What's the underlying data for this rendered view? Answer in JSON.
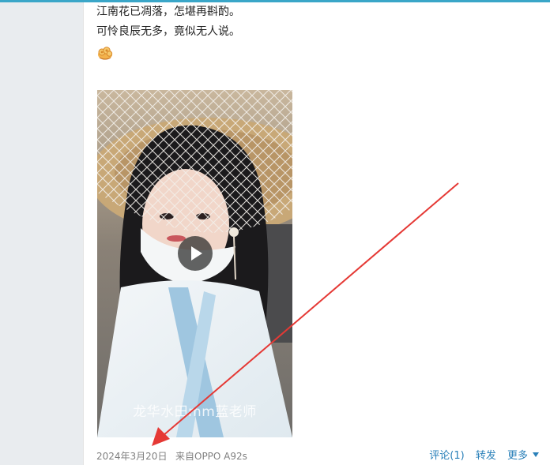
{
  "post": {
    "line1": "江南花已凋落，怎堪再斟酌。",
    "line2": "可怜良辰无多，竟似无人说。",
    "emoji_icon": "flower-bouquet-icon"
  },
  "video": {
    "watermark": "龙华水田mm蓝老师",
    "play_icon": "play-icon"
  },
  "footer": {
    "date": "2024年3月20日",
    "source": "来自OPPO A92s",
    "comment_label": "评论(1)",
    "repost_label": "转发",
    "more_label": "更多"
  },
  "colors": {
    "accent_top_bar": "#3aa6c8",
    "link": "#2a80b9",
    "annotation_arrow": "#e53935",
    "meta_text": "#808080"
  }
}
